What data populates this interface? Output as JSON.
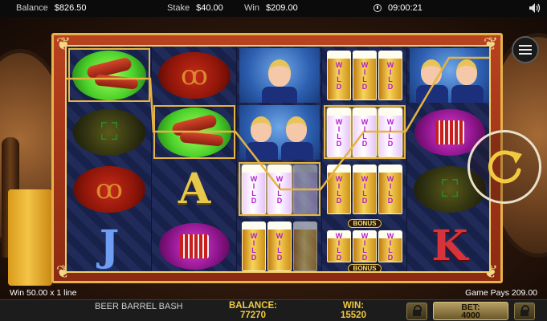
{
  "topbar": {
    "balance_label": "Balance",
    "balance_value": "$826.50",
    "stake_label": "Stake",
    "stake_value": "$40.00",
    "win_label": "Win",
    "win_value": "$209.00",
    "time": "09:00:21"
  },
  "reels": [
    [
      "sausage",
      "hat",
      "pretzel",
      "J"
    ],
    [
      "pretzel",
      "sausage",
      "A",
      "accordion"
    ],
    [
      "girl",
      "girls",
      "wild",
      "wild"
    ],
    [
      "wild",
      "wild",
      "wild",
      "wild-bonus"
    ],
    [
      "girls",
      "accordion",
      "hat",
      "K"
    ]
  ],
  "symbols": {
    "wild_text": "WILD",
    "bonus_text": "BONUS",
    "letter_A": "A",
    "letter_J": "J",
    "letter_K": "K"
  },
  "info": {
    "win_line": "Win 50.00 x 1 line",
    "game_pays": "Game Pays 209.00"
  },
  "bottombar": {
    "title": "BEER BARREL BASH",
    "balance_label": "BALANCE:",
    "balance_value": "77270",
    "win_label": "WIN:",
    "win_value": "15520",
    "bet_label": "BET:",
    "bet_value": "4000"
  },
  "colors": {
    "accent_gold": "#f3c940",
    "frame_red": "#b8421f",
    "highlight": "#e5b343"
  },
  "icons": [
    "clock-icon",
    "speaker-icon",
    "menu-icon",
    "spin-icon",
    "lock-icon"
  ]
}
